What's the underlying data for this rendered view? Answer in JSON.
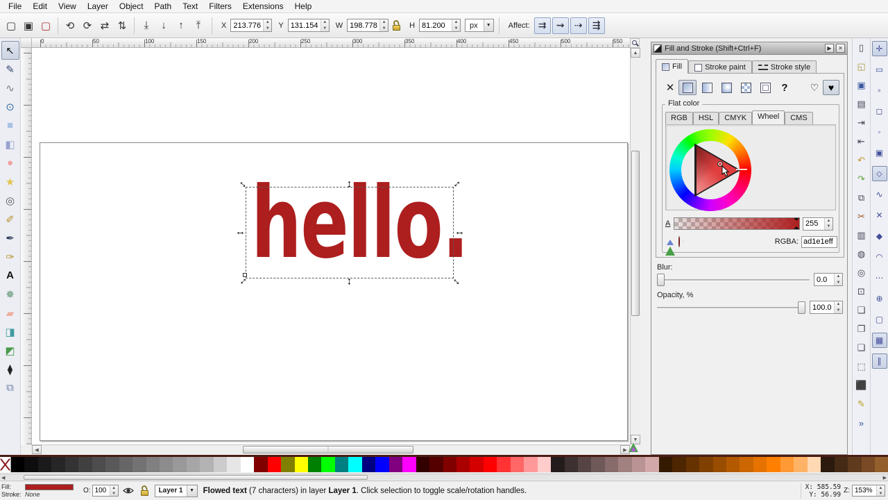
{
  "menu": {
    "items": [
      "File",
      "Edit",
      "View",
      "Layer",
      "Object",
      "Path",
      "Text",
      "Filters",
      "Extensions",
      "Help"
    ]
  },
  "toolbar": {
    "icon_groups": [
      [
        "select-all",
        "select-all-in-all-layers",
        "deselect"
      ],
      [
        "rotate-90-ccw",
        "rotate-90-cw",
        "flip-horizontal",
        "flip-vertical"
      ],
      [
        "lower-to-bottom",
        "lower",
        "raise",
        "raise-to-top"
      ]
    ],
    "x_label": "X",
    "x_value": "213.776",
    "y_label": "Y",
    "y_value": "131.154",
    "w_label": "W",
    "w_value": "198.778",
    "h_label": "H",
    "h_value": "81.200",
    "units": "px",
    "affect_label": "Affect:",
    "affect_buttons": [
      "scale-stroke-toggle",
      "scale-corners-toggle",
      "move-gradients-toggle",
      "move-patterns-toggle"
    ]
  },
  "rulers": {
    "top_numbers": [
      "0",
      "50",
      "100",
      "150",
      "200",
      "250",
      "300",
      "350",
      "400",
      "450",
      "500",
      "550"
    ]
  },
  "toolbox": {
    "tools": [
      "selector",
      "node-editor",
      "tweak",
      "zoom",
      "rectangle",
      "box-3d",
      "ellipse",
      "star",
      "spiral",
      "pencil",
      "bezier-pen",
      "calligraphy",
      "text",
      "spray",
      "eraser",
      "paint-bucket",
      "gradient",
      "dropper",
      "connector"
    ],
    "selected": "selector"
  },
  "canvas": {
    "text": "hello.",
    "text_color": "#ad1e1e"
  },
  "panel": {
    "title": "Fill and Stroke (Shift+Ctrl+F)",
    "tabs": [
      {
        "name": "tab-fill",
        "label": "Fill",
        "active": true
      },
      {
        "name": "tab-stroke-paint",
        "label": "Stroke paint",
        "active": false
      },
      {
        "name": "tab-stroke-style",
        "label": "Stroke style",
        "active": false
      }
    ],
    "fill_types": [
      "no-paint",
      "flat-color",
      "linear-gradient",
      "radial-gradient",
      "pattern",
      "swatch",
      "unknown"
    ],
    "fill_type_active": "flat-color",
    "fill_rules": [
      "fill-rule-evenodd",
      "fill-rule-nonzero"
    ],
    "fill_rule_active": "fill-rule-nonzero",
    "group_label": "Flat color",
    "color_tabs": [
      "RGB",
      "HSL",
      "CMYK",
      "Wheel",
      "CMS"
    ],
    "color_tab_active": "Wheel",
    "alpha_label": "A",
    "alpha_value": "255",
    "rgba_label": "RGBA:",
    "rgba_value": "ad1e1eff",
    "current_color": "#ad1e1e",
    "blur_label": "Blur:",
    "blur_value": "0.0",
    "opacity_label": "Opacity, %",
    "opacity_value": "100.0"
  },
  "commands_bar": [
    "new-document",
    "open-document",
    "save-document",
    "print-document",
    "import-bitmap",
    "export-bitmap",
    "undo",
    "redo",
    "copy",
    "cut",
    "paste",
    "zoom-to-selection",
    "zoom-to-drawing",
    "zoom-to-page",
    "duplicate",
    "create-clone",
    "unlink-clone",
    "select-dialog",
    "transform-dialog",
    "fill-stroke-dialog",
    "overflow"
  ],
  "snap_bar": {
    "items": [
      "enable-snapping",
      "snap-bounding-box",
      "snap-bbox-edges",
      "snap-bbox-corners",
      "snap-bbox-midpoints",
      "snap-bbox-centers",
      "snap-nodes",
      "snap-paths",
      "snap-path-intersections",
      "snap-cusp-nodes",
      "snap-smooth-nodes",
      "snap-midpoints",
      "snap-object-centers",
      "snap-page-border",
      "snap-grids",
      "snap-guides"
    ],
    "pressed": [
      "enable-snapping",
      "snap-nodes",
      "snap-grids",
      "snap-guides"
    ]
  },
  "palette": {
    "colors": [
      "#000000",
      "#0d0d0d",
      "#1a1a1a",
      "#262626",
      "#333333",
      "#404040",
      "#4d4d4d",
      "#595959",
      "#666666",
      "#737373",
      "#808080",
      "#8c8c8c",
      "#999999",
      "#a6a6a6",
      "#b3b3b3",
      "#cccccc",
      "#e6e6e6",
      "#ffffff",
      "#800000",
      "#ff0000",
      "#808000",
      "#ffff00",
      "#008000",
      "#00ff00",
      "#008080",
      "#00ffff",
      "#000080",
      "#0000ff",
      "#800080",
      "#ff00ff",
      "#330000",
      "#550000",
      "#800000",
      "#aa0000",
      "#d40000",
      "#ff0000",
      "#ff3333",
      "#ff6666",
      "#ff9999",
      "#ffcccc",
      "#241c1c",
      "#3d3030",
      "#564444",
      "#6f5858",
      "#886c6c",
      "#a18080",
      "#ba9494",
      "#d3a8a8",
      "#331a00",
      "#4d2600",
      "#663300",
      "#804000",
      "#994d00",
      "#b35900",
      "#cc6600",
      "#e67300",
      "#ff8000",
      "#ff9933",
      "#ffb366",
      "#ffd9b3",
      "#2b1a0d",
      "#452a15",
      "#5f3a1d",
      "#794a25",
      "#93602d"
    ]
  },
  "statusbar": {
    "fill_label": "Fill:",
    "stroke_label": "Stroke:",
    "stroke_value": "None",
    "opacity_label": "O:",
    "opacity_value": "100",
    "layer_name": "Layer 1",
    "message": {
      "b1": "Flowed text",
      "t1": " (7 characters) in layer ",
      "b2": "Layer 1",
      "t2": ". Click selection to toggle scale/rotation handles."
    },
    "x_label": "X:",
    "x_value": "585.59",
    "y_label": "Y:",
    "y_value": "56.99",
    "z_label": "Z:",
    "zoom_value": "153%"
  }
}
